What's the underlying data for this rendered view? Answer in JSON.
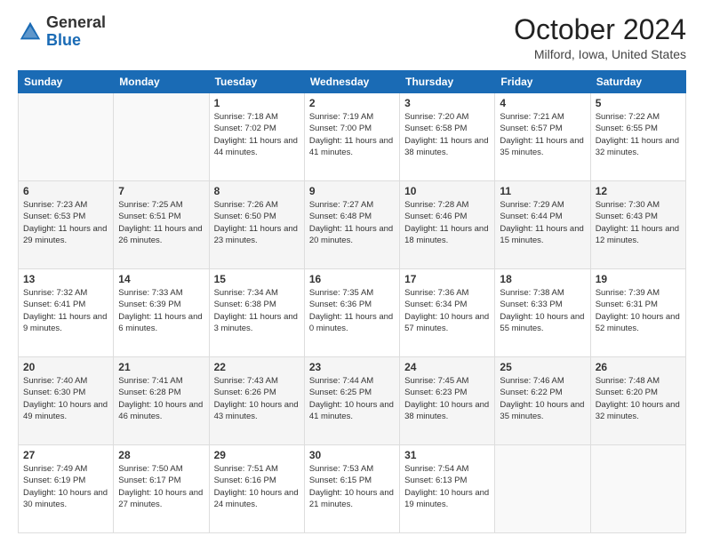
{
  "header": {
    "logo_general": "General",
    "logo_blue": "Blue",
    "month": "October 2024",
    "location": "Milford, Iowa, United States"
  },
  "weekdays": [
    "Sunday",
    "Monday",
    "Tuesday",
    "Wednesday",
    "Thursday",
    "Friday",
    "Saturday"
  ],
  "weeks": [
    [
      {
        "day": "",
        "info": ""
      },
      {
        "day": "",
        "info": ""
      },
      {
        "day": "1",
        "info": "Sunrise: 7:18 AM\nSunset: 7:02 PM\nDaylight: 11 hours and 44 minutes."
      },
      {
        "day": "2",
        "info": "Sunrise: 7:19 AM\nSunset: 7:00 PM\nDaylight: 11 hours and 41 minutes."
      },
      {
        "day": "3",
        "info": "Sunrise: 7:20 AM\nSunset: 6:58 PM\nDaylight: 11 hours and 38 minutes."
      },
      {
        "day": "4",
        "info": "Sunrise: 7:21 AM\nSunset: 6:57 PM\nDaylight: 11 hours and 35 minutes."
      },
      {
        "day": "5",
        "info": "Sunrise: 7:22 AM\nSunset: 6:55 PM\nDaylight: 11 hours and 32 minutes."
      }
    ],
    [
      {
        "day": "6",
        "info": "Sunrise: 7:23 AM\nSunset: 6:53 PM\nDaylight: 11 hours and 29 minutes."
      },
      {
        "day": "7",
        "info": "Sunrise: 7:25 AM\nSunset: 6:51 PM\nDaylight: 11 hours and 26 minutes."
      },
      {
        "day": "8",
        "info": "Sunrise: 7:26 AM\nSunset: 6:50 PM\nDaylight: 11 hours and 23 minutes."
      },
      {
        "day": "9",
        "info": "Sunrise: 7:27 AM\nSunset: 6:48 PM\nDaylight: 11 hours and 20 minutes."
      },
      {
        "day": "10",
        "info": "Sunrise: 7:28 AM\nSunset: 6:46 PM\nDaylight: 11 hours and 18 minutes."
      },
      {
        "day": "11",
        "info": "Sunrise: 7:29 AM\nSunset: 6:44 PM\nDaylight: 11 hours and 15 minutes."
      },
      {
        "day": "12",
        "info": "Sunrise: 7:30 AM\nSunset: 6:43 PM\nDaylight: 11 hours and 12 minutes."
      }
    ],
    [
      {
        "day": "13",
        "info": "Sunrise: 7:32 AM\nSunset: 6:41 PM\nDaylight: 11 hours and 9 minutes."
      },
      {
        "day": "14",
        "info": "Sunrise: 7:33 AM\nSunset: 6:39 PM\nDaylight: 11 hours and 6 minutes."
      },
      {
        "day": "15",
        "info": "Sunrise: 7:34 AM\nSunset: 6:38 PM\nDaylight: 11 hours and 3 minutes."
      },
      {
        "day": "16",
        "info": "Sunrise: 7:35 AM\nSunset: 6:36 PM\nDaylight: 11 hours and 0 minutes."
      },
      {
        "day": "17",
        "info": "Sunrise: 7:36 AM\nSunset: 6:34 PM\nDaylight: 10 hours and 57 minutes."
      },
      {
        "day": "18",
        "info": "Sunrise: 7:38 AM\nSunset: 6:33 PM\nDaylight: 10 hours and 55 minutes."
      },
      {
        "day": "19",
        "info": "Sunrise: 7:39 AM\nSunset: 6:31 PM\nDaylight: 10 hours and 52 minutes."
      }
    ],
    [
      {
        "day": "20",
        "info": "Sunrise: 7:40 AM\nSunset: 6:30 PM\nDaylight: 10 hours and 49 minutes."
      },
      {
        "day": "21",
        "info": "Sunrise: 7:41 AM\nSunset: 6:28 PM\nDaylight: 10 hours and 46 minutes."
      },
      {
        "day": "22",
        "info": "Sunrise: 7:43 AM\nSunset: 6:26 PM\nDaylight: 10 hours and 43 minutes."
      },
      {
        "day": "23",
        "info": "Sunrise: 7:44 AM\nSunset: 6:25 PM\nDaylight: 10 hours and 41 minutes."
      },
      {
        "day": "24",
        "info": "Sunrise: 7:45 AM\nSunset: 6:23 PM\nDaylight: 10 hours and 38 minutes."
      },
      {
        "day": "25",
        "info": "Sunrise: 7:46 AM\nSunset: 6:22 PM\nDaylight: 10 hours and 35 minutes."
      },
      {
        "day": "26",
        "info": "Sunrise: 7:48 AM\nSunset: 6:20 PM\nDaylight: 10 hours and 32 minutes."
      }
    ],
    [
      {
        "day": "27",
        "info": "Sunrise: 7:49 AM\nSunset: 6:19 PM\nDaylight: 10 hours and 30 minutes."
      },
      {
        "day": "28",
        "info": "Sunrise: 7:50 AM\nSunset: 6:17 PM\nDaylight: 10 hours and 27 minutes."
      },
      {
        "day": "29",
        "info": "Sunrise: 7:51 AM\nSunset: 6:16 PM\nDaylight: 10 hours and 24 minutes."
      },
      {
        "day": "30",
        "info": "Sunrise: 7:53 AM\nSunset: 6:15 PM\nDaylight: 10 hours and 21 minutes."
      },
      {
        "day": "31",
        "info": "Sunrise: 7:54 AM\nSunset: 6:13 PM\nDaylight: 10 hours and 19 minutes."
      },
      {
        "day": "",
        "info": ""
      },
      {
        "day": "",
        "info": ""
      }
    ]
  ]
}
